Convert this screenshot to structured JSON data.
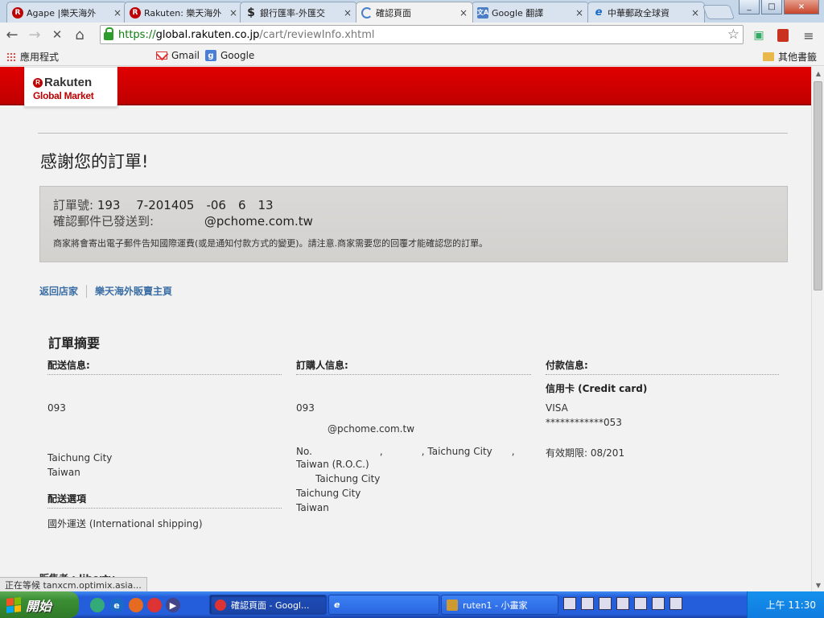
{
  "tabs": [
    {
      "title": "Agape |樂天海外",
      "icon": "rakuten-icon"
    },
    {
      "title": "Rakuten: 樂天海外",
      "icon": "rakuten-icon"
    },
    {
      "title": "銀行匯率-外匯交",
      "icon": "dollar-icon"
    },
    {
      "title": "確認頁面",
      "icon": "loading-icon"
    },
    {
      "title": "Google 翻譯",
      "icon": "translate-icon"
    },
    {
      "title": "中華郵政全球資",
      "icon": "ie-icon"
    }
  ],
  "tab_close": "×",
  "window_buttons": {
    "minimize": "_",
    "maximize": "□",
    "close": "×"
  },
  "toolbar": {
    "back": "←",
    "forward": "→",
    "stop": "✕",
    "home": "⌂",
    "url_scheme": "https://",
    "url_domain": "global.rakuten.co.jp",
    "url_path": "/cart/reviewInfo.xhtml",
    "star": "☆",
    "menu": "≡"
  },
  "bookmarks": {
    "apps": "應用程式",
    "gmail": "Gmail",
    "google": "Google",
    "google_icon": "g",
    "other": "其他書籤"
  },
  "site": {
    "logo_r": "R",
    "logo_top": "Rakuten",
    "logo_bottom": "Global Market"
  },
  "page": {
    "thanks": "感謝您的訂單!",
    "order_label": "訂單號:",
    "order_number": "193　 7-201405　-06　6　13",
    "email_label": "確認郵件已發送到:",
    "email_value": "@pchome.com.tw",
    "notice_text": "商家將會寄出電子郵件告知國際運費(或是通知付款方式的變更)。請注意.商家需要您的回覆才能確認您的訂單。",
    "link_store": "返回店家",
    "link_main": "樂天海外販賣主頁",
    "summary_title": "訂單摘要"
  },
  "shipping": {
    "heading": "配送信息:",
    "phone": "093",
    "city": "Taichung City",
    "country": "Taiwan",
    "option_heading": "配送選項",
    "option_value": "國外運送 (International shipping)"
  },
  "buyer": {
    "heading": "訂購人信息:",
    "phone": "093",
    "email": "@pchome.com.tw",
    "address_line": "No.　　　　　　　,　　　　, Taichung City　　,",
    "country_roc": "Taiwan (R.O.C.)",
    "city_indent": "Taichung City",
    "city": "Taichung City",
    "country": "Taiwan"
  },
  "payment": {
    "heading": "付款信息:",
    "method": "信用卡 (Credit card)",
    "card_type": "VISA",
    "card_number": "************053",
    "expiry": "有效期限: 08/201"
  },
  "status_bar": "正在等候 tanxcm.optimix.asia...",
  "seller_peek": "販售者 : liberty",
  "taskbar": {
    "start": "開始",
    "task_chrome": "確認頁面 - Googl...",
    "task_paint": "ruten1 - 小畫家",
    "clock": "上午 11:30"
  },
  "colors": {
    "rakuten_red": "#bf0000",
    "link_blue": "#3b6ea5",
    "secure_green": "#0b7b0b"
  }
}
